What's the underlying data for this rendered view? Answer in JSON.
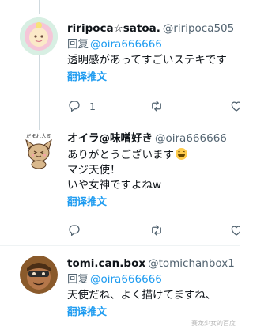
{
  "tweets": [
    {
      "name": "riripoca☆satoa.",
      "handle": "@riripoca505",
      "reply_prefix": "回复",
      "reply_to": "@oira666666",
      "lines": [
        "透明感があってすごいステキです"
      ],
      "translate": "翻译推文",
      "reply_count": "1",
      "avatar_colors": {
        "ring": "#cdeadf",
        "inner": "#f5c6d8",
        "face": "#fbe9c8"
      }
    },
    {
      "name": "オイラ@味噌好き",
      "handle": "@oira666666",
      "lines": [
        "ありがとうございます",
        "マジ天使！",
        "いや女神ですよねw"
      ],
      "translate": "翻译推文",
      "avatar_label": "だまれ人間",
      "avatar_colors": {
        "body": "#d9b88c",
        "dark": "#5a3b22",
        "cheek": "#f3a5a5"
      }
    },
    {
      "name": "tomi.can.box",
      "handle": "@tomichanbox1",
      "reply_prefix": "回复",
      "reply_to": "@oira666666",
      "lines": [
        "天使だね、よく描けてますね、"
      ],
      "translate": "翻译推文",
      "avatar_colors": {
        "bg": "#8a5a2b",
        "face": "#b5774a",
        "mask": "#2b2b2b"
      }
    }
  ],
  "watermark": "赛龙少女的百度",
  "colors": {
    "link": "#1d9bf0",
    "secondary_text": "#536471",
    "divider": "#eff3f4",
    "thread_line": "#cfd9de"
  }
}
